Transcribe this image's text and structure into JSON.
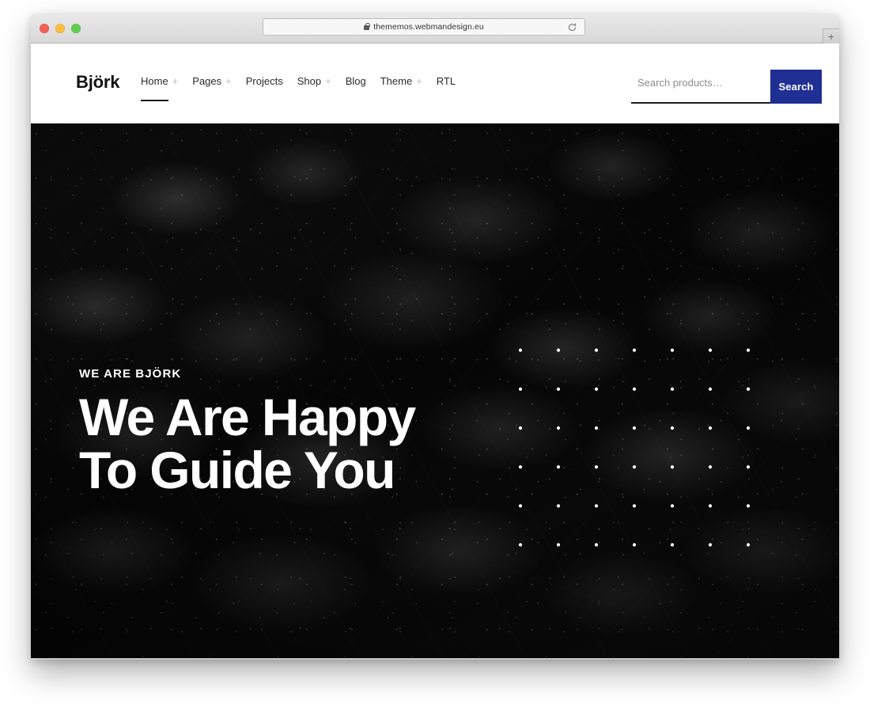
{
  "browser": {
    "url": "thememos.webmandesign.eu",
    "lock_icon": "lock-icon",
    "reload_icon": "reload-icon",
    "new_tab_label": "+",
    "traffic_lights": [
      {
        "name": "close",
        "color": "#f35f57"
      },
      {
        "name": "minimize",
        "color": "#fbbe3f"
      },
      {
        "name": "maximize",
        "color": "#5fcd4f"
      }
    ]
  },
  "header": {
    "brand": "Björk",
    "nav": [
      {
        "label": "Home",
        "plus": "+",
        "active": true
      },
      {
        "label": "Pages",
        "plus": "+",
        "active": false
      },
      {
        "label": "Projects",
        "plus": "",
        "active": false
      },
      {
        "label": "Shop",
        "plus": "+",
        "active": false
      },
      {
        "label": "Blog",
        "plus": "",
        "active": false
      },
      {
        "label": "Theme",
        "plus": "+",
        "active": false
      },
      {
        "label": "RTL",
        "plus": "",
        "active": false
      }
    ],
    "search": {
      "placeholder": "Search products…",
      "value": "",
      "button_label": "Search",
      "button_color": "#1f2f94"
    }
  },
  "hero": {
    "eyebrow": "WE ARE BJÖRK",
    "title_line1": "We Are Happy",
    "title_line2": "To Guide You",
    "background": "dark-foliage-photo",
    "dot_grid": {
      "columns": 8,
      "rows": 7,
      "dot_color": "#ffffff"
    }
  }
}
